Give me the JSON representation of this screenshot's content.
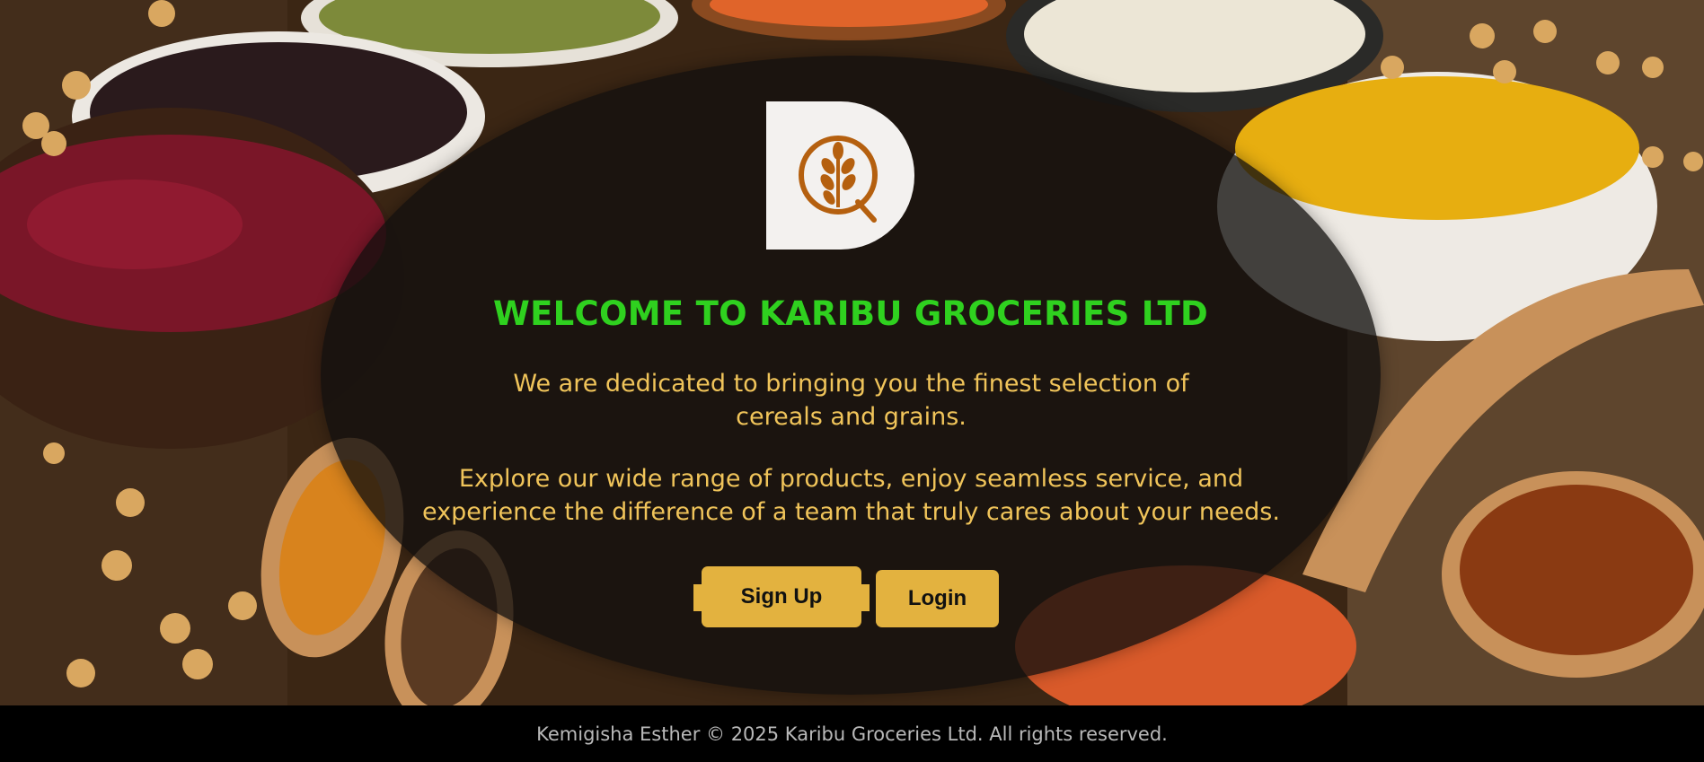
{
  "hero": {
    "title": "WELCOME TO KARIBU GROCERIES LTD",
    "intro_line1": "We are dedicated to bringing you the finest selection of",
    "intro_line2": "cereals and grains.",
    "explore_line1": "Explore our wide range of products, enjoy seamless service, and",
    "explore_line2": "experience the difference of a team that truly cares about your needs."
  },
  "actions": {
    "signup_label": "Sign Up",
    "login_label": "Login"
  },
  "footer": {
    "text": "Kemigisha Esther © 2025 Karibu Groceries Ltd. All rights reserved."
  },
  "colors": {
    "title_green": "#2fd11f",
    "text_gold": "#f0c45a",
    "button_gold": "#e3b23f",
    "logo_brown": "#b5600f"
  },
  "icons": {
    "logo": "grain-wheat-logo-icon"
  }
}
